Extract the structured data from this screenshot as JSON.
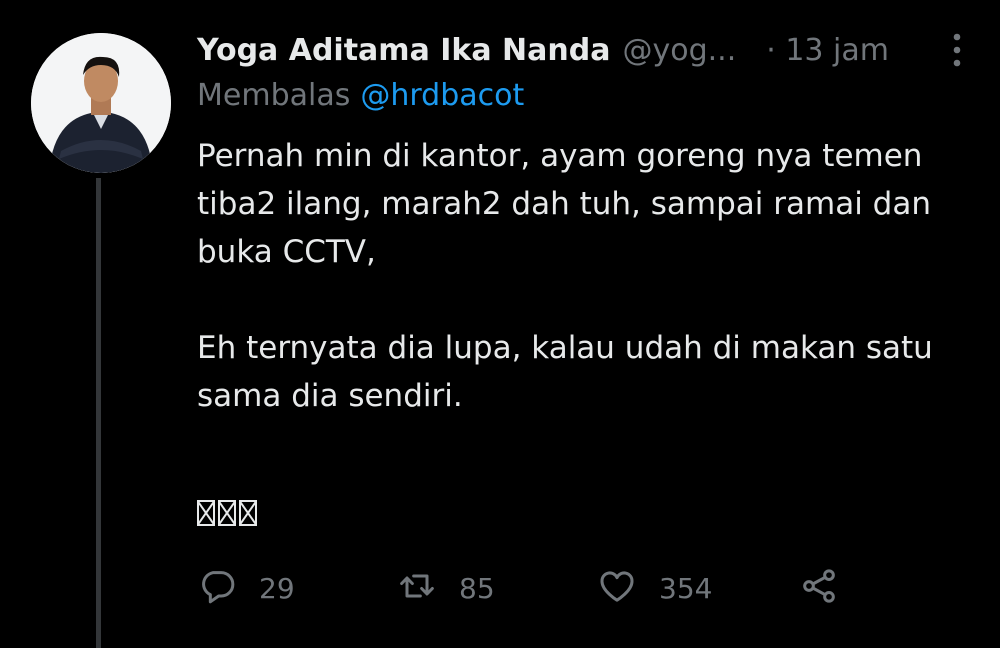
{
  "tweet": {
    "author_name": "Yoga Aditama Ika Nanda",
    "author_handle": "@yog...",
    "time": "· 13 jam",
    "reply_prefix": "Membalas",
    "reply_to": "@hrdbacot",
    "paragraph1": "Pernah min di kantor, ayam goreng nya temen tiba2 ilang, marah2 dah tuh, sampai ramai dan buka CCTV,",
    "paragraph2": "Eh ternyata dia lupa, kalau udah di makan satu sama dia sendiri.",
    "emoji_count": 3
  },
  "actions": {
    "reply_count": "29",
    "retweet_count": "85",
    "like_count": "354"
  },
  "icons": {
    "more": "more-vertical-icon",
    "reply": "reply-bubble-icon",
    "retweet": "retweet-icon",
    "like": "heart-icon",
    "share": "share-icon"
  },
  "colors": {
    "background": "#000000",
    "text": "#e7e9ea",
    "muted": "#71767b",
    "mention": "#1d9bf0",
    "thread_line": "#333639"
  }
}
